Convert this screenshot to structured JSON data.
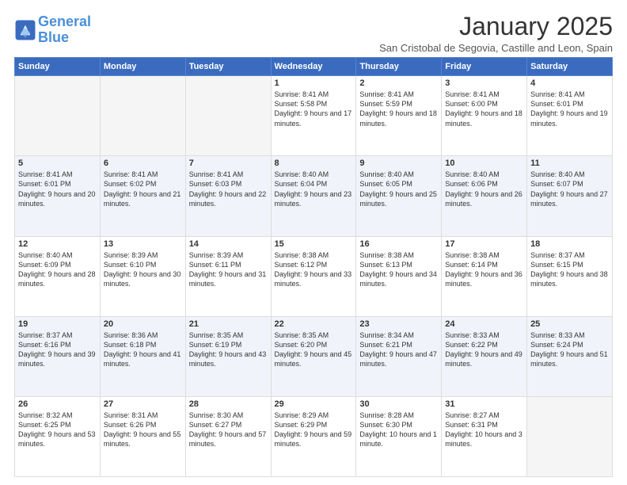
{
  "logo": {
    "line1": "General",
    "line2": "Blue"
  },
  "title": "January 2025",
  "location": "San Cristobal de Segovia, Castille and Leon, Spain",
  "weekdays": [
    "Sunday",
    "Monday",
    "Tuesday",
    "Wednesday",
    "Thursday",
    "Friday",
    "Saturday"
  ],
  "weeks": [
    [
      {
        "day": "",
        "content": ""
      },
      {
        "day": "",
        "content": ""
      },
      {
        "day": "",
        "content": ""
      },
      {
        "day": "1",
        "content": "Sunrise: 8:41 AM\nSunset: 5:58 PM\nDaylight: 9 hours and 17 minutes."
      },
      {
        "day": "2",
        "content": "Sunrise: 8:41 AM\nSunset: 5:59 PM\nDaylight: 9 hours and 18 minutes."
      },
      {
        "day": "3",
        "content": "Sunrise: 8:41 AM\nSunset: 6:00 PM\nDaylight: 9 hours and 18 minutes."
      },
      {
        "day": "4",
        "content": "Sunrise: 8:41 AM\nSunset: 6:01 PM\nDaylight: 9 hours and 19 minutes."
      }
    ],
    [
      {
        "day": "5",
        "content": "Sunrise: 8:41 AM\nSunset: 6:01 PM\nDaylight: 9 hours and 20 minutes."
      },
      {
        "day": "6",
        "content": "Sunrise: 8:41 AM\nSunset: 6:02 PM\nDaylight: 9 hours and 21 minutes."
      },
      {
        "day": "7",
        "content": "Sunrise: 8:41 AM\nSunset: 6:03 PM\nDaylight: 9 hours and 22 minutes."
      },
      {
        "day": "8",
        "content": "Sunrise: 8:40 AM\nSunset: 6:04 PM\nDaylight: 9 hours and 23 minutes."
      },
      {
        "day": "9",
        "content": "Sunrise: 8:40 AM\nSunset: 6:05 PM\nDaylight: 9 hours and 25 minutes."
      },
      {
        "day": "10",
        "content": "Sunrise: 8:40 AM\nSunset: 6:06 PM\nDaylight: 9 hours and 26 minutes."
      },
      {
        "day": "11",
        "content": "Sunrise: 8:40 AM\nSunset: 6:07 PM\nDaylight: 9 hours and 27 minutes."
      }
    ],
    [
      {
        "day": "12",
        "content": "Sunrise: 8:40 AM\nSunset: 6:09 PM\nDaylight: 9 hours and 28 minutes."
      },
      {
        "day": "13",
        "content": "Sunrise: 8:39 AM\nSunset: 6:10 PM\nDaylight: 9 hours and 30 minutes."
      },
      {
        "day": "14",
        "content": "Sunrise: 8:39 AM\nSunset: 6:11 PM\nDaylight: 9 hours and 31 minutes."
      },
      {
        "day": "15",
        "content": "Sunrise: 8:38 AM\nSunset: 6:12 PM\nDaylight: 9 hours and 33 minutes."
      },
      {
        "day": "16",
        "content": "Sunrise: 8:38 AM\nSunset: 6:13 PM\nDaylight: 9 hours and 34 minutes."
      },
      {
        "day": "17",
        "content": "Sunrise: 8:38 AM\nSunset: 6:14 PM\nDaylight: 9 hours and 36 minutes."
      },
      {
        "day": "18",
        "content": "Sunrise: 8:37 AM\nSunset: 6:15 PM\nDaylight: 9 hours and 38 minutes."
      }
    ],
    [
      {
        "day": "19",
        "content": "Sunrise: 8:37 AM\nSunset: 6:16 PM\nDaylight: 9 hours and 39 minutes."
      },
      {
        "day": "20",
        "content": "Sunrise: 8:36 AM\nSunset: 6:18 PM\nDaylight: 9 hours and 41 minutes."
      },
      {
        "day": "21",
        "content": "Sunrise: 8:35 AM\nSunset: 6:19 PM\nDaylight: 9 hours and 43 minutes."
      },
      {
        "day": "22",
        "content": "Sunrise: 8:35 AM\nSunset: 6:20 PM\nDaylight: 9 hours and 45 minutes."
      },
      {
        "day": "23",
        "content": "Sunrise: 8:34 AM\nSunset: 6:21 PM\nDaylight: 9 hours and 47 minutes."
      },
      {
        "day": "24",
        "content": "Sunrise: 8:33 AM\nSunset: 6:22 PM\nDaylight: 9 hours and 49 minutes."
      },
      {
        "day": "25",
        "content": "Sunrise: 8:33 AM\nSunset: 6:24 PM\nDaylight: 9 hours and 51 minutes."
      }
    ],
    [
      {
        "day": "26",
        "content": "Sunrise: 8:32 AM\nSunset: 6:25 PM\nDaylight: 9 hours and 53 minutes."
      },
      {
        "day": "27",
        "content": "Sunrise: 8:31 AM\nSunset: 6:26 PM\nDaylight: 9 hours and 55 minutes."
      },
      {
        "day": "28",
        "content": "Sunrise: 8:30 AM\nSunset: 6:27 PM\nDaylight: 9 hours and 57 minutes."
      },
      {
        "day": "29",
        "content": "Sunrise: 8:29 AM\nSunset: 6:29 PM\nDaylight: 9 hours and 59 minutes."
      },
      {
        "day": "30",
        "content": "Sunrise: 8:28 AM\nSunset: 6:30 PM\nDaylight: 10 hours and 1 minute."
      },
      {
        "day": "31",
        "content": "Sunrise: 8:27 AM\nSunset: 6:31 PM\nDaylight: 10 hours and 3 minutes."
      },
      {
        "day": "",
        "content": ""
      }
    ]
  ]
}
